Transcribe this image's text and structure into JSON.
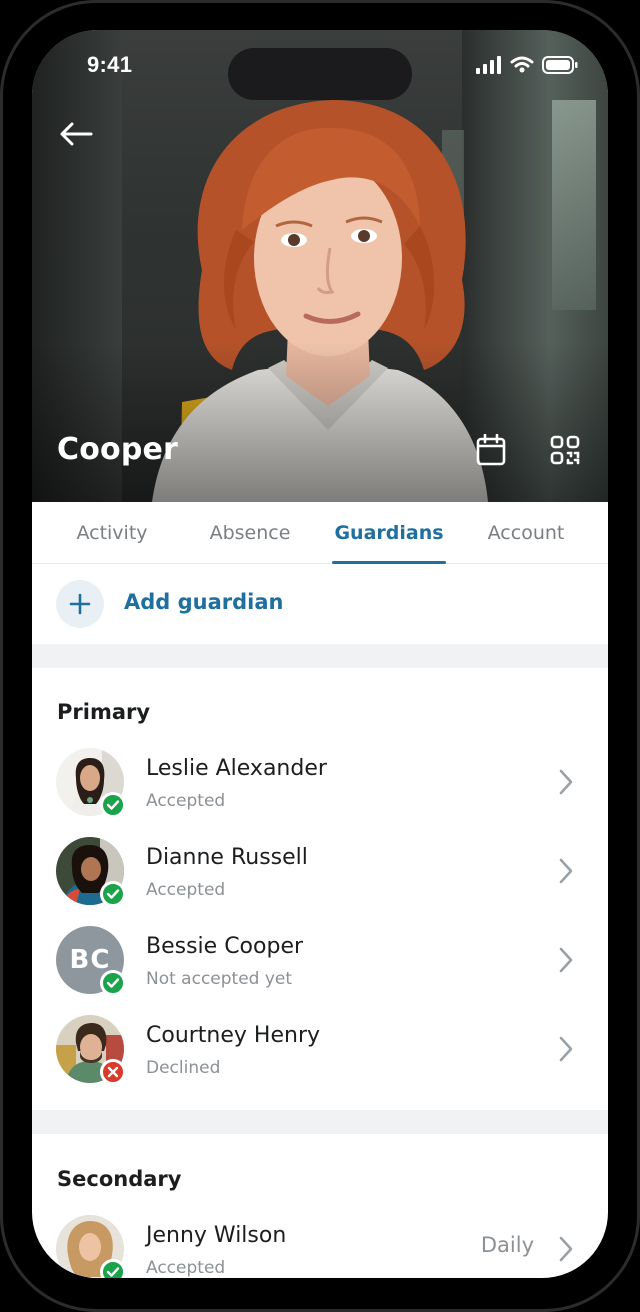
{
  "status_bar": {
    "time": "9:41"
  },
  "hero": {
    "title": "Cooper"
  },
  "tabs": [
    {
      "label": "Activity",
      "active": false
    },
    {
      "label": "Absence",
      "active": false
    },
    {
      "label": "Guardians",
      "active": true
    },
    {
      "label": "Account",
      "active": false
    }
  ],
  "add_guardian": {
    "label": "Add guardian"
  },
  "sections": {
    "primary": {
      "title": "Primary",
      "guardians": [
        {
          "name": "Leslie Alexander",
          "status": "Accepted",
          "status_icon": "check"
        },
        {
          "name": "Dianne Russell",
          "status": "Accepted",
          "status_icon": "check"
        },
        {
          "name": "Bessie Cooper",
          "status": "Not accepted yet",
          "status_icon": "check",
          "initials": "BC"
        },
        {
          "name": "Courtney Henry",
          "status": "Declined",
          "status_icon": "cross"
        }
      ]
    },
    "secondary": {
      "title": "Secondary",
      "guardians": [
        {
          "name": "Jenny Wilson",
          "status": "Accepted",
          "status_icon": "check",
          "frequency": "Daily"
        }
      ]
    }
  },
  "colors": {
    "accent": "#1f6f9f",
    "success": "#1aa34a",
    "danger": "#d93a2b",
    "muted_text": "#8c9196",
    "section_gap": "#f1f2f3"
  },
  "icons": [
    "back-arrow-icon",
    "calendar-icon",
    "qr-code-icon",
    "plus-icon",
    "chevron-right-icon",
    "check-icon",
    "cross-icon",
    "signal-icon",
    "wifi-icon",
    "battery-icon"
  ]
}
